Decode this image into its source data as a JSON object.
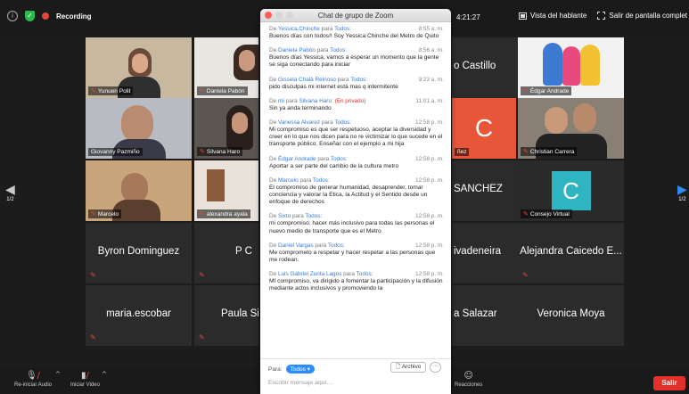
{
  "topbar": {
    "recording_label": "Recording",
    "timer_partial": "4:21:27",
    "speaker_view_label": "Vista del hablante",
    "exit_fullscreen_label": "Salir de pantalla complet"
  },
  "tiles": {
    "t1": "Yunuen Polit",
    "t2": "Daniela Pabón",
    "t3": "o Castillo",
    "t4": "Édgar Andrade",
    "t5": "Giovanny Pazmiño",
    "t6": "Silvana Haro",
    "t7": "C",
    "t7b": "ñez",
    "t8": "Christian Carrera",
    "t9": "Marcelo",
    "t10": "alexandra ayala",
    "t11": "SANCHEZ",
    "t12_letter": "C",
    "t12": "Consejo Virtual",
    "t13": "Byron Dominguez",
    "t14": "P C",
    "t15": "ivadeneira",
    "t16": "Alejandra Caicedo E...",
    "t17": "maria.escobar",
    "t18": "Paula Si",
    "t19": "a Salazar",
    "t20": "Veronica Moya"
  },
  "nav": {
    "left_page": "1/2",
    "right_page": "1/2"
  },
  "chat": {
    "title": "Chat de grupo de Zoom",
    "messages": [
      {
        "prefix": "De ",
        "from": "Yessica.Chinche",
        "mid": " para ",
        "to": "Todos",
        "suffix": ":",
        "time": "8:55 a. m.",
        "text": "Buenos días con todos!! Soy Yessica Chinche  del Metro de Quito"
      },
      {
        "prefix": "De ",
        "from": "Daniela Pabón",
        "mid": " para ",
        "to": "Todos",
        "suffix": ":",
        "time": "8:56 a. m.",
        "text": "Buenos días Yessica, vamos a esperar un momento que la gente se siga conectando para iniciar"
      },
      {
        "prefix": "De ",
        "from": "Gissela Chalá Reinoso",
        "mid": " para ",
        "to": "Todos",
        "suffix": ":",
        "time": "9:23 a. m.",
        "text": "pido disculpas mi internet está mas q intermitente"
      },
      {
        "prefix": "De ",
        "from": "mí",
        "mid": " para ",
        "to": "Silvana Haro",
        "suffix": ": ",
        "private": "(En privado)",
        "time": "11:01 a. m.",
        "text": "Sin ya anda terminando"
      },
      {
        "prefix": "De ",
        "from": "Vanessa Alvarez",
        "mid": " para ",
        "to": "Todos",
        "suffix": ":",
        "time": "12:58 p. m.",
        "text": "Mi compromiso es que ser respetuoso, aceptar la diversidad y creer en lo que nos dicen para no re victimizar lo que sucede en el transporte público. Enseñar con el ejemplo a mi hija"
      },
      {
        "prefix": "De ",
        "from": "Édgar Andrade",
        "mid": " para ",
        "to": "Todos",
        "suffix": ":",
        "time": "12:58 p. m.",
        "text": "Aportar a ser parte del cambio de la cultura metro"
      },
      {
        "prefix": "De ",
        "from": "Marcelo",
        "mid": " para ",
        "to": "Todos",
        "suffix": ":",
        "time": "12:58 p. m.",
        "text": "El compromiso de generar humanidad, desaprender, tomar conciencia y valorar la Etica, la Actitud y el Sentido desde un enfoque de derechos"
      },
      {
        "prefix": "De ",
        "from": "Sixto",
        "mid": " para ",
        "to": "Todos",
        "suffix": ":",
        "time": "12:58 p. m.",
        "text": "mi compromiso: hacer más inclusivo para todas las personas el nuevo  medio de transporte que es el Metro"
      },
      {
        "prefix": "De ",
        "from": "Daniel Vargas",
        "mid": " para ",
        "to": "Todos",
        "suffix": ":",
        "time": "12:58 p. m.",
        "text": "Me comprometo a respetar y hacer respetar a las personas que me rodean."
      },
      {
        "prefix": "De ",
        "from": "Luis Gabriel Zurita Lagos",
        "mid": " para ",
        "to": "Todos",
        "suffix": ":",
        "time": "12:58 p. m.",
        "text": "MI compromiso, va dirigido a fomentar la participación y la difusión mediante actos inclusivos y promoviendo la"
      }
    ],
    "to_label": "Para:",
    "to_value": "Todos",
    "file_label": "Archivo",
    "more_label": "···",
    "input_placeholder": "Escribir mensaje aquí…"
  },
  "bottombar": {
    "audio_label": "Re-iniciar Audio",
    "video_label": "Iniciar Video",
    "reactions_label": "Reacciones",
    "leave_label": "Salir"
  }
}
